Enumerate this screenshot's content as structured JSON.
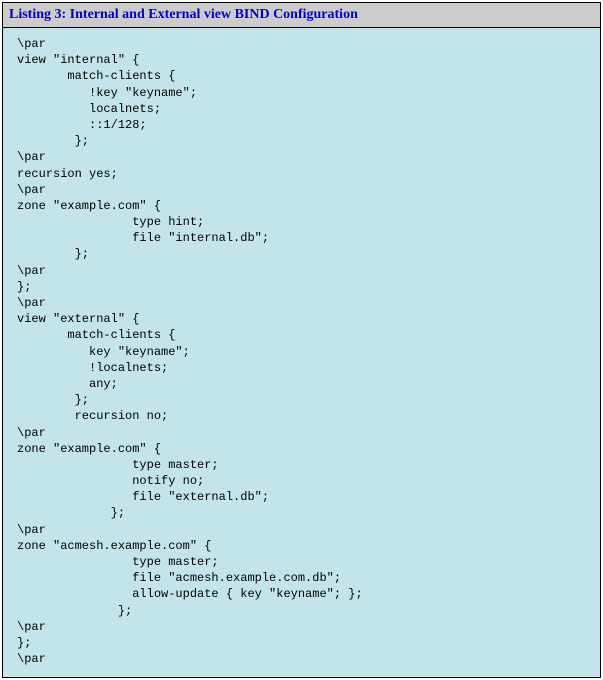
{
  "listing": {
    "caption": "Listing 3: Internal and External view BIND Configuration",
    "code": "\\par\nview \"internal\" {\n       match-clients {\n          !key \"keyname\";\n          localnets;\n          ::1/128;\n        };\n\\par\nrecursion yes;\n\\par\nzone \"example.com\" {\n                type hint;\n                file \"internal.db\";\n        };\n\\par\n};\n\\par\nview \"external\" {\n       match-clients {\n          key \"keyname\";\n          !localnets;\n          any;\n        };\n        recursion no;\n\\par\nzone \"example.com\" {\n                type master;\n                notify no;\n                file \"external.db\";\n             };\n\\par\nzone \"acmesh.example.com\" {\n                type master;\n                file \"acmesh.example.com.db\";\n                allow-update { key \"keyname\"; };\n              };\n\\par\n};\n\\par"
  }
}
